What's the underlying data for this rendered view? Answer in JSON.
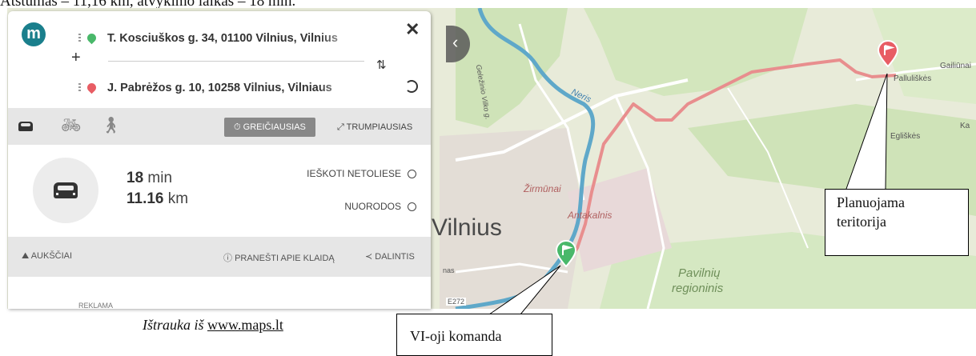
{
  "document": {
    "top_caption": "Atstumas – 11,16 km, atvykimo laikas – 18 min.",
    "source_caption_prefix": "Ištrauka iš ",
    "source_link": "www.maps.lt"
  },
  "panel": {
    "logo": "m",
    "origin_address": "T. Kosciuškos g. 34, 01100 Vilnius, Vilnius",
    "destination_address": "J. Pabrėžos g. 10, 10258 Vilnius, Vilniaus",
    "add_stop": "+",
    "close": "✕",
    "swap": "⇅",
    "modes": [
      "car-icon",
      "bicycle-icon",
      "walk-icon"
    ],
    "option_fastest": "GREIČIAUSIAS",
    "option_shortest": "TRUMPIAUSIAS",
    "duration_value": "18",
    "duration_unit": "min",
    "distance_value": "11.16",
    "distance_unit": "km",
    "search_nearby": "IEŠKOTI NETOLIESE",
    "directions": "NUORODOS",
    "elevation": "AUKŠČIAI",
    "report_error": "PRANEŠTI APIE KLAIDĄ",
    "share": "DALINTIS",
    "ad_label": "REKLAMA"
  },
  "map": {
    "labels": {
      "vilnius": "Vilnius",
      "neris": "Neris",
      "zirmunai": "Žirmūnai",
      "antakalnis": "Antakalnis",
      "pavilniu": "Pavilnių",
      "regioninis": "regioninis",
      "palluliskes": "Palluliškės",
      "gailiunai": "Gailiūnai",
      "egliskes": "Egliškės",
      "geleziniovilko": "Geležinio Vilko g.",
      "ka": "Ka",
      "e272": "E272",
      "nas": "nas"
    },
    "route_color": "#e88e8e",
    "river_color": "#5fa8c9"
  },
  "callouts": {
    "planned_area_line1": "Planuojama",
    "planned_area_line2": "teritorija",
    "team": "VI-oji komanda"
  }
}
